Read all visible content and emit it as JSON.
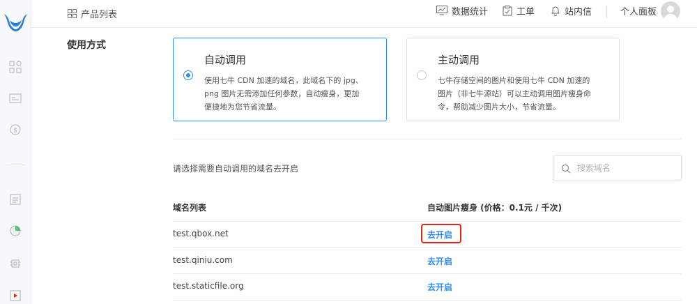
{
  "topbar": {
    "products_label": "产品列表",
    "nav_items": [
      {
        "label": "数据统计",
        "icon": "chart-icon"
      },
      {
        "label": "工单",
        "icon": "ticket-icon"
      },
      {
        "label": "站内信",
        "icon": "bell-icon"
      }
    ],
    "user_panel": "个人面板"
  },
  "usage": {
    "label": "使用方式",
    "options": [
      {
        "title": "自动调用",
        "description": "使用七牛 CDN 加速的域名，此域名下的 jpg、png 图片无需添加任何参数，自动瘦身，更加便捷地为您节省流量。",
        "selected": true
      },
      {
        "title": "主动调用",
        "description": "七牛存储空间的图片和使用七牛 CDN 加速的图片（非七牛源站）可以主动调用图片瘦身命令，帮助减少图片大小，节省流量。",
        "selected": false
      }
    ]
  },
  "domain_select": {
    "instruction": "请选择需要自动调用的域名去开启",
    "search_placeholder": "搜索域名"
  },
  "table": {
    "headers": [
      "域名列表",
      "自动图片瘦身 (价格：0.1元 / 千次)"
    ],
    "rows": [
      {
        "domain": "test.qbox.net",
        "action": "去开启",
        "highlighted": true
      },
      {
        "domain": "test.qiniu.com",
        "action": "去开启",
        "highlighted": false
      },
      {
        "domain": "test.staticfile.org",
        "action": "去开启",
        "highlighted": false
      }
    ]
  },
  "colors": {
    "accent": "#2d8cf0",
    "highlight_border": "#e0261b",
    "logo": "#2b7bd4"
  }
}
